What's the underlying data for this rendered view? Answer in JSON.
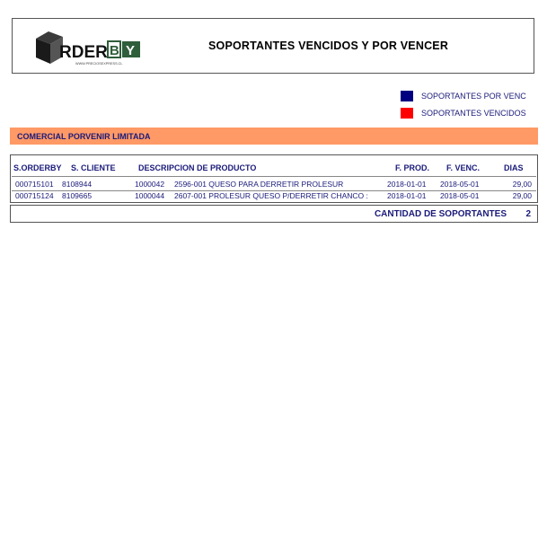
{
  "header": {
    "logo_text": "ORDERBY",
    "logo_url": "WWW.PRECIOSEXPRESS.CL",
    "title": "SOPORTANTES VENCIDOS Y POR VENCER"
  },
  "legend": [
    {
      "label": "SOPORTANTES POR VENC",
      "color": "#000080"
    },
    {
      "label": "SOPORTANTES VENCIDOS",
      "color": "#ff0000"
    }
  ],
  "company": "COMERCIAL PORVENIR LIMITADA",
  "table": {
    "headers": {
      "orderby": "S.ORDERBY",
      "cliente": "S. CLIENTE",
      "descripcion": "DESCRIPCION DE PRODUCTO",
      "fprod": "F. PROD.",
      "fvenc": "F. VENC.",
      "dias": "DIAS"
    },
    "rows": [
      {
        "orderby": "000715101",
        "cliente": "8108944",
        "codigo": "1000042",
        "descripcion": "2596-001 QUESO PARA DERRETIR PROLESUR",
        "fprod": "2018-01-01",
        "fvenc": "2018-05-01",
        "dias": "29,00"
      },
      {
        "orderby": "000715124",
        "cliente": "8109665",
        "codigo": "1000044",
        "descripcion": "2607-001 PROLESUR QUESO P/DERRETIR CHANCO :",
        "fprod": "2018-01-01",
        "fvenc": "2018-05-01",
        "dias": "29,00"
      }
    ]
  },
  "total": {
    "label": "CANTIDAD DE SOPORTANTES",
    "value": "2"
  }
}
